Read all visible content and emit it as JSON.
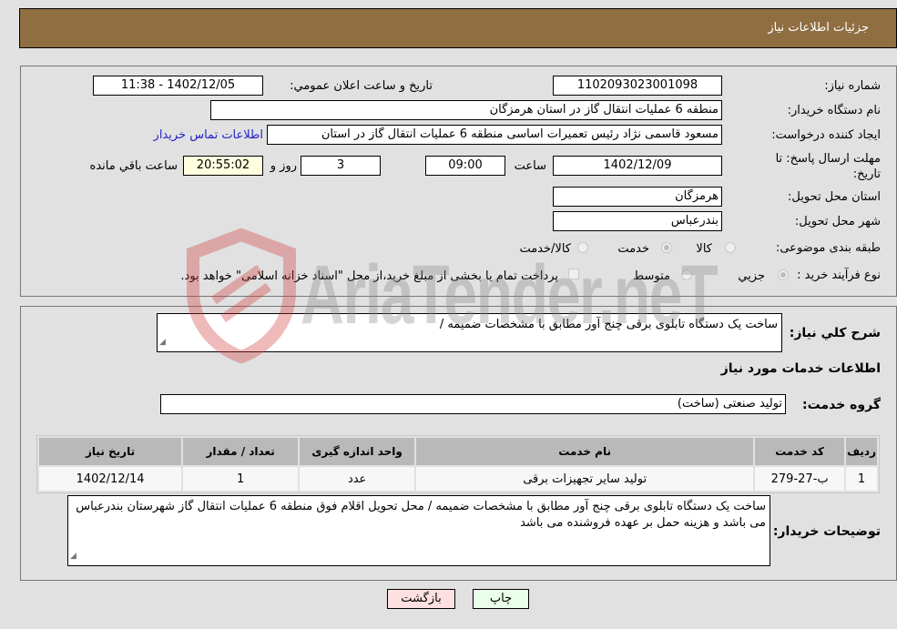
{
  "header": {
    "title": "جزئيات اطلاعات نياز"
  },
  "form": {
    "need_number": {
      "label": "شماره نياز:",
      "value": "1102093023001098"
    },
    "announce_datetime": {
      "label": "تاريخ و ساعت اعلان عمومي:",
      "value": "1402/12/05 - 11:38"
    },
    "buyer_org": {
      "label": "نام دستگاه خريدار:",
      "value": "منطقه 6 عمليات انتقال گاز در استان هرمزگان"
    },
    "creator": {
      "label": "ايجاد كننده درخواست:",
      "value": "مسعود قاسمی نژاد رئیس تعمیرات اساسی منطقه 6 عملیات انتقال گاز در استان",
      "contact_link": "اطلاعات تماس خريدار"
    },
    "deadline": {
      "label": "مهلت ارسال پاسخ: تا تاريخ:",
      "date": "1402/12/09",
      "time_label": "ساعت",
      "time": "09:00",
      "days": "3",
      "days_label": "روز و",
      "remaining": "20:55:02",
      "remaining_label": "ساعت باقي مانده"
    },
    "delivery_province": {
      "label": "استان محل تحويل:",
      "value": "هرمزگان"
    },
    "delivery_city": {
      "label": "شهر محل تحويل:",
      "value": "بندرعباس"
    },
    "category": {
      "label": "طبقه بندی موضوعی:",
      "options": [
        "كالا",
        "خدمت",
        "كالا/خدمت"
      ],
      "selected": "خدمت"
    },
    "purchase_type": {
      "label": "نوع فرآيند خريد :",
      "options": [
        "جزيي",
        "متوسط"
      ],
      "selected": "جزيي",
      "treasury_note": "پرداخت تمام يا بخشی از مبلغ خريد،از محل \"اسناد خزانه اسلامی\" خواهد بود."
    }
  },
  "summary": {
    "label": "شرح كلي نياز:",
    "value": "ساخت یک دستگاه تابلوی برقی چنج آور مطابق با مشخصات ضمیمه  /"
  },
  "services_section": {
    "title": "اطلاعات خدمات مورد نياز",
    "group_label": "گروه خدمت:",
    "group_value": "توليد صنعتی (ساخت)",
    "table": {
      "columns": [
        "رديف",
        "كد خدمت",
        "نام خدمت",
        "واحد اندازه گيری",
        "تعداد / مقدار",
        "تاريخ نياز"
      ],
      "rows": [
        [
          "1",
          "ب-27-279",
          "توليد ساير تجهيزات برقی",
          "عدد",
          "1",
          "1402/12/14"
        ]
      ]
    }
  },
  "buyer_notes": {
    "label": "توضيحات خريدار:",
    "value": "ساخت یک دستگاه تابلوی برقی چنج آور مطابق با مشخصات ضمیمه  / محل تحویل اقلام فوق منطقه 6 عملیات انتقال گاز شهرستان بندرعباس می باشد و هزینه حمل بر عهده فروشنده می باشد"
  },
  "buttons": {
    "print": "چاپ",
    "back": "بازگشت"
  },
  "colors": {
    "header_bg": "#8f6e42",
    "print_bg": "#eaffea",
    "back_bg": "#ffe0e0",
    "link": "#2222cc",
    "remaining_bg": "#ffffe0"
  },
  "watermark": {
    "text": "AriaTender.neT"
  }
}
